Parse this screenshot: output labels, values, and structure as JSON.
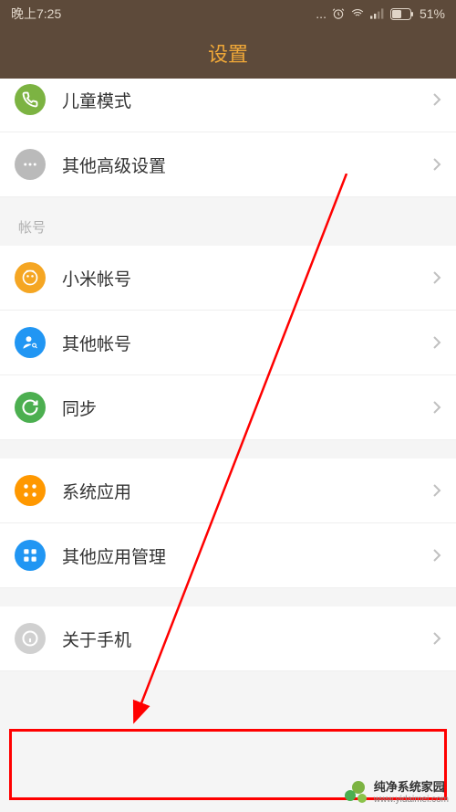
{
  "status": {
    "time": "晚上7:25",
    "battery": "51%"
  },
  "header": {
    "title": "设置"
  },
  "items": {
    "child_mode": {
      "label": "儿童模式",
      "icon": "handset-icon"
    },
    "advanced": {
      "label": "其他高级设置",
      "icon": "dots-icon"
    },
    "mi_account": {
      "label": "小米帐号",
      "icon": "mi-icon"
    },
    "other_accounts": {
      "label": "其他帐号",
      "icon": "person-key-icon"
    },
    "sync": {
      "label": "同步",
      "icon": "sync-icon"
    },
    "system_apps": {
      "label": "系统应用",
      "icon": "grid-icon"
    },
    "other_apps": {
      "label": "其他应用管理",
      "icon": "apps-icon"
    },
    "about": {
      "label": "关于手机",
      "icon": "info-icon"
    }
  },
  "sections": {
    "accounts": "帐号"
  },
  "watermark": {
    "text": "纯净系统家园",
    "url": "www.yidaimei.com"
  }
}
